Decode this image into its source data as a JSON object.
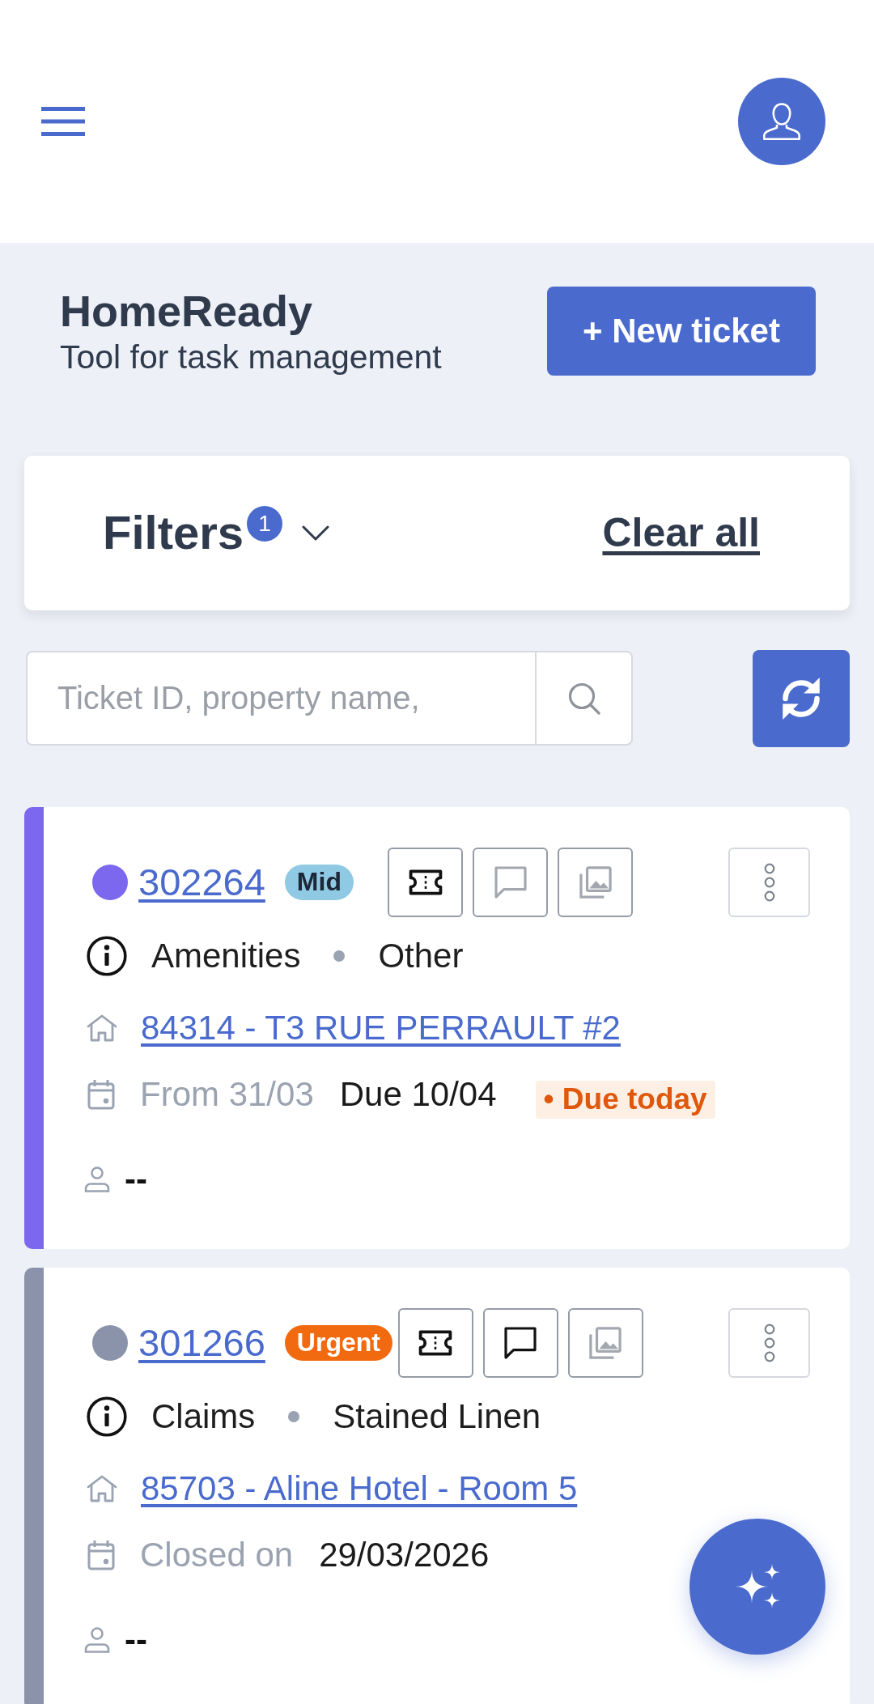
{
  "app": {
    "title": "HomeReady",
    "subtitle": "Tool for task management",
    "new_ticket": "+ New ticket"
  },
  "filters": {
    "label": "Filters",
    "count": "1",
    "expanded": false,
    "clear_all": "Clear all"
  },
  "search": {
    "placeholder": "Ticket ID, property name,"
  },
  "tickets": [
    {
      "id": "302264",
      "color": "#7b68ee",
      "priority": {
        "label": "Mid",
        "kind": "medium"
      },
      "actions": [
        {
          "kind": "ticket",
          "active": true
        },
        {
          "kind": "comments",
          "active": false
        },
        {
          "kind": "photos",
          "active": false
        }
      ],
      "category": "Amenities",
      "subcategory": "Other",
      "property": "84314 - T3 RUE PERRAULT #2",
      "schedule": [
        {
          "text": "From 31/03",
          "muted": true
        },
        {
          "text": "Due 10/04",
          "muted": false
        }
      ],
      "due_tag": "• Due today",
      "assignee": "--"
    },
    {
      "id": "301266",
      "color": "#8a93a9",
      "priority": {
        "label": "Urgent",
        "kind": "urgent"
      },
      "actions": [
        {
          "kind": "ticket",
          "active": true
        },
        {
          "kind": "comments",
          "active": true
        },
        {
          "kind": "photos",
          "active": false
        }
      ],
      "category": "Claims",
      "subcategory": "Stained Linen",
      "property": "85703 - Aline Hotel - Room 5",
      "schedule": [
        {
          "text": "Closed on",
          "muted": true
        },
        {
          "text": "29/03/2026",
          "muted": false
        }
      ],
      "assignee": "--"
    }
  ]
}
